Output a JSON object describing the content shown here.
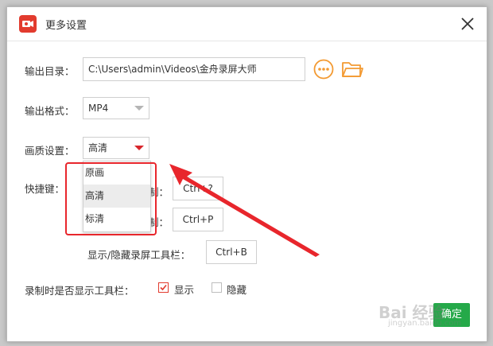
{
  "window": {
    "title": "更多设置"
  },
  "output_dir": {
    "label": "输出目录：",
    "value": "C:\\Users\\admin\\Videos\\金舟录屏大师"
  },
  "output_format": {
    "label": "输出格式：",
    "value": "MP4"
  },
  "quality": {
    "label": "画质设置：",
    "value": "高清",
    "options": [
      "原画",
      "高清",
      "标清"
    ],
    "selected_index": 1
  },
  "hotkeys": {
    "label": "快捷键：",
    "row1_label_tail": "制：",
    "row1_value": "Ctrl+?",
    "row2_label_tail": "制：",
    "row2_value": "Ctrl+P",
    "row3_label": "显示/隐藏录屏工具栏：",
    "row3_value": "Ctrl+B"
  },
  "toolbar_display": {
    "label": "录制时是否显示工具栏：",
    "show_label": "显示",
    "show_checked": true,
    "hide_label": "隐藏",
    "hide_checked": false
  },
  "ok_button": {
    "label": "确定"
  },
  "watermark": {
    "text": "Bai 经验",
    "sub": "jingyan.baidu.com"
  },
  "icons": [
    "app-logo-icon",
    "close-icon",
    "more-icon",
    "folder-icon",
    "dropdown-arrow-icon",
    "checkmark-icon"
  ],
  "colors": {
    "accent": "#e23b2e",
    "folder": "#f39a32",
    "annotation": "#e8262c",
    "ok": "#25a949"
  }
}
